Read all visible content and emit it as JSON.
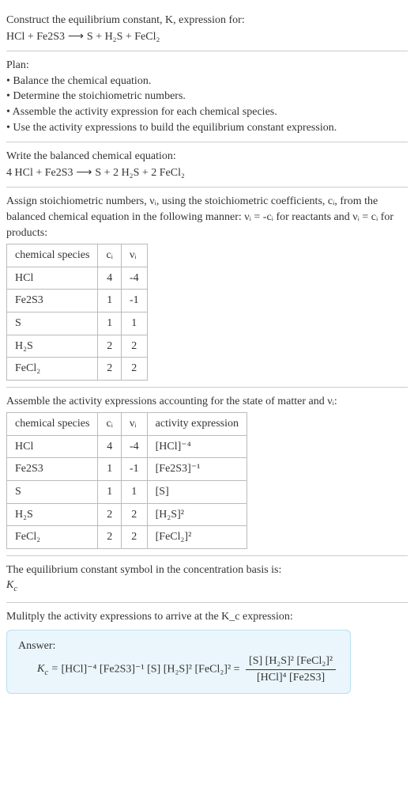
{
  "intro": {
    "line1": "Construct the equilibrium constant, K, expression for:",
    "eq_lhs": "HCl + Fe2S3",
    "arrow": " ⟶ ",
    "eq_rhs": "S + H₂S + FeCl₂"
  },
  "plan": {
    "heading": "Plan:",
    "items": [
      "Balance the chemical equation.",
      "Determine the stoichiometric numbers.",
      "Assemble the activity expression for each chemical species.",
      "Use the activity expressions to build the equilibrium constant expression."
    ]
  },
  "balanced": {
    "heading": "Write the balanced chemical equation:",
    "lhs": "4 HCl + Fe2S3",
    "arrow": " ⟶ ",
    "rhs": "S + 2 H₂S + 2 FeCl₂"
  },
  "stoich": {
    "intro1": "Assign stoichiometric numbers, νᵢ, using the stoichiometric coefficients, cᵢ, from the balanced chemical equation in the following manner: νᵢ = -cᵢ for reactants and νᵢ = cᵢ for products:",
    "headers": [
      "chemical species",
      "cᵢ",
      "νᵢ"
    ],
    "rows": [
      {
        "species": "HCl",
        "c": "4",
        "v": "-4"
      },
      {
        "species": "Fe2S3",
        "c": "1",
        "v": "-1"
      },
      {
        "species": "S",
        "c": "1",
        "v": "1"
      },
      {
        "species": "H₂S",
        "c": "2",
        "v": "2"
      },
      {
        "species": "FeCl₂",
        "c": "2",
        "v": "2"
      }
    ]
  },
  "activity": {
    "intro": "Assemble the activity expressions accounting for the state of matter and νᵢ:",
    "headers": [
      "chemical species",
      "cᵢ",
      "νᵢ",
      "activity expression"
    ],
    "rows": [
      {
        "species": "HCl",
        "c": "4",
        "v": "-4",
        "expr": "[HCl]⁻⁴"
      },
      {
        "species": "Fe2S3",
        "c": "1",
        "v": "-1",
        "expr": "[Fe2S3]⁻¹"
      },
      {
        "species": "S",
        "c": "1",
        "v": "1",
        "expr": "[S]"
      },
      {
        "species": "H₂S",
        "c": "2",
        "v": "2",
        "expr": "[H₂S]²"
      },
      {
        "species": "FeCl₂",
        "c": "2",
        "v": "2",
        "expr": "[FeCl₂]²"
      }
    ]
  },
  "kc_symbol": {
    "line": "The equilibrium constant symbol in the concentration basis is:",
    "sym": "K_c"
  },
  "final": {
    "intro": "Mulitply the activity expressions to arrive at the K_c expression:",
    "answer_label": "Answer:",
    "kc": "K_c = ",
    "product": "[HCl]⁻⁴ [Fe2S3]⁻¹ [S] [H₂S]² [FeCl₂]² = ",
    "frac_num": "[S] [H₂S]² [FeCl₂]²",
    "frac_den": "[HCl]⁴ [Fe2S3]"
  },
  "chart_data": {
    "type": "table",
    "tables": [
      {
        "name": "stoichiometric numbers",
        "columns": [
          "chemical species",
          "c_i",
          "v_i"
        ],
        "rows": [
          [
            "HCl",
            4,
            -4
          ],
          [
            "Fe2S3",
            1,
            -1
          ],
          [
            "S",
            1,
            1
          ],
          [
            "H2S",
            2,
            2
          ],
          [
            "FeCl2",
            2,
            2
          ]
        ]
      },
      {
        "name": "activity expressions",
        "columns": [
          "chemical species",
          "c_i",
          "v_i",
          "activity expression"
        ],
        "rows": [
          [
            "HCl",
            4,
            -4,
            "[HCl]^-4"
          ],
          [
            "Fe2S3",
            1,
            -1,
            "[Fe2S3]^-1"
          ],
          [
            "S",
            1,
            1,
            "[S]"
          ],
          [
            "H2S",
            2,
            2,
            "[H2S]^2"
          ],
          [
            "FeCl2",
            2,
            2,
            "[FeCl2]^2"
          ]
        ]
      }
    ]
  }
}
